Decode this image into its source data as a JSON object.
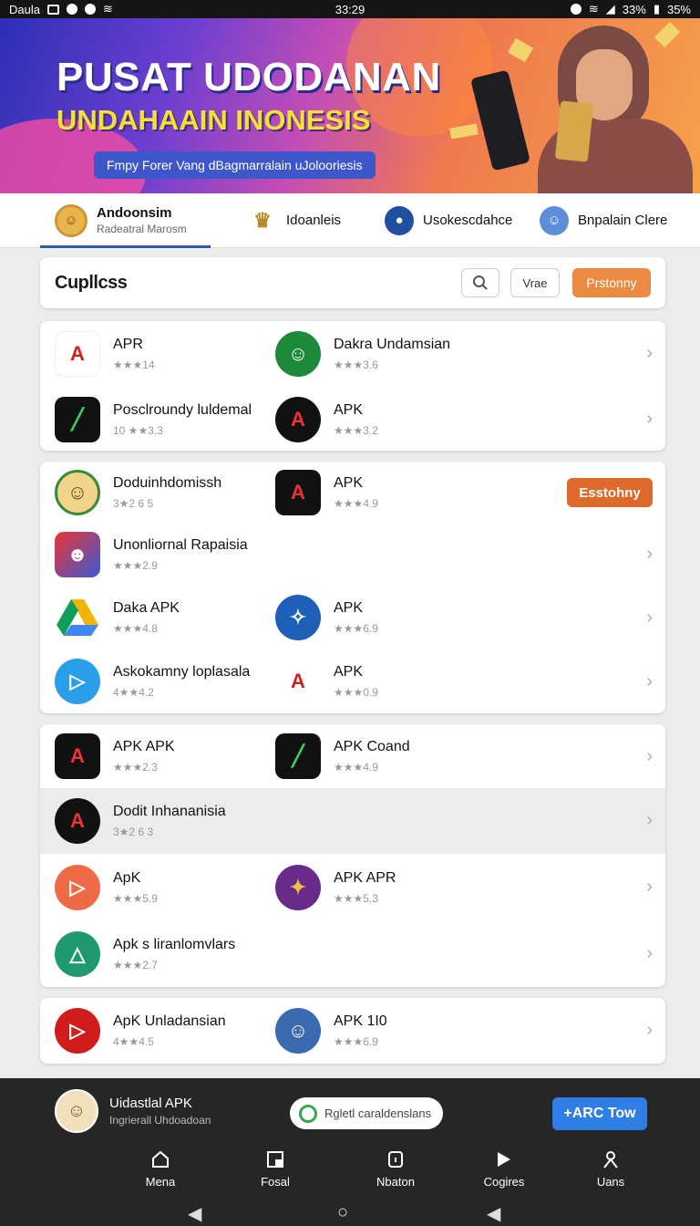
{
  "status_bar": {
    "left_label": "Daula",
    "time": "33:29",
    "battery_left": "33%",
    "battery_right": "35%"
  },
  "banner": {
    "title": "PUSAT UDODANAN",
    "subtitle": "UNDAHAAIN INONESIS",
    "tagline": "Fmpy Forer Vang dBagmarralain uJolooriesis"
  },
  "tabs": [
    {
      "label": "Andoonsim",
      "sublabel": "Radeatral Marosm",
      "active": true
    },
    {
      "label": "Idoanleis"
    },
    {
      "label": "Usokescdahce"
    },
    {
      "label": "Bnpalain Clere"
    }
  ],
  "toolbar": {
    "title": "Cupllcss",
    "filter_label": "Vrae",
    "primary_label": "Prstonny"
  },
  "sections": [
    {
      "rows": [
        {
          "left": {
            "name": "APR",
            "rating": "★★★14"
          },
          "right": {
            "name": "Dakra Undamsian",
            "rating": "★★★3.6"
          }
        },
        {
          "left": {
            "name": "Posclroundy luldemal",
            "rating": "10 ★★3.3"
          },
          "right": {
            "name": "APK",
            "rating": "★★★3.2"
          }
        }
      ]
    },
    {
      "rows": [
        {
          "left": {
            "name": "Doduinhdomissh",
            "rating": "3★2 6 5"
          },
          "right": {
            "name": "APK",
            "rating": "★★★4.9"
          },
          "button": "Esstohny"
        },
        {
          "left": {
            "name": "Unonliornal Rapaisia",
            "rating": "★★★2.9"
          }
        },
        {
          "left": {
            "name": "Daka APK",
            "rating": "★★★4.8"
          },
          "right": {
            "name": "APK",
            "rating": "★★★6.9"
          }
        },
        {
          "left": {
            "name": "Askokamny loplasala",
            "rating": "4★★4.2"
          },
          "right": {
            "name": "APK",
            "rating": "★★★0.9"
          }
        }
      ]
    },
    {
      "rows": [
        {
          "left": {
            "name": "APK APK",
            "rating": "★★★2.3"
          },
          "right": {
            "name": "APK  Coand",
            "rating": "★★★4.9"
          }
        },
        {
          "left": {
            "name": "Dodit Inhananisia",
            "rating": "3★2 6 3"
          }
        },
        {
          "left": {
            "name": "ApK",
            "rating": "★★★5.9"
          },
          "right": {
            "name": "APK APR",
            "rating": "★★★5.3"
          }
        },
        {
          "left": {
            "name": "Apk s liranlomvlars",
            "rating": "★★★2.7"
          }
        }
      ]
    },
    {
      "rows": [
        {
          "left": {
            "name": "ApK Unladansian",
            "rating": "4★★4.5"
          },
          "right": {
            "name": "APK 1I0",
            "rating": "★★★6.9"
          }
        }
      ]
    }
  ],
  "bottom": {
    "promo_title": "Uidastlal APK",
    "promo_sub": "Ingrierall Uhdoadoan",
    "search_pill": "Rgletl caraldenslans",
    "cta": "+ARC Tow",
    "nav": [
      "Mena",
      "Fosal",
      "Nbaton",
      "Cogires",
      "Uans"
    ]
  },
  "colors": {
    "accent_orange": "#ea8a43",
    "cta_blue": "#2f7ee6",
    "tab_underline": "#2f5aa8"
  }
}
